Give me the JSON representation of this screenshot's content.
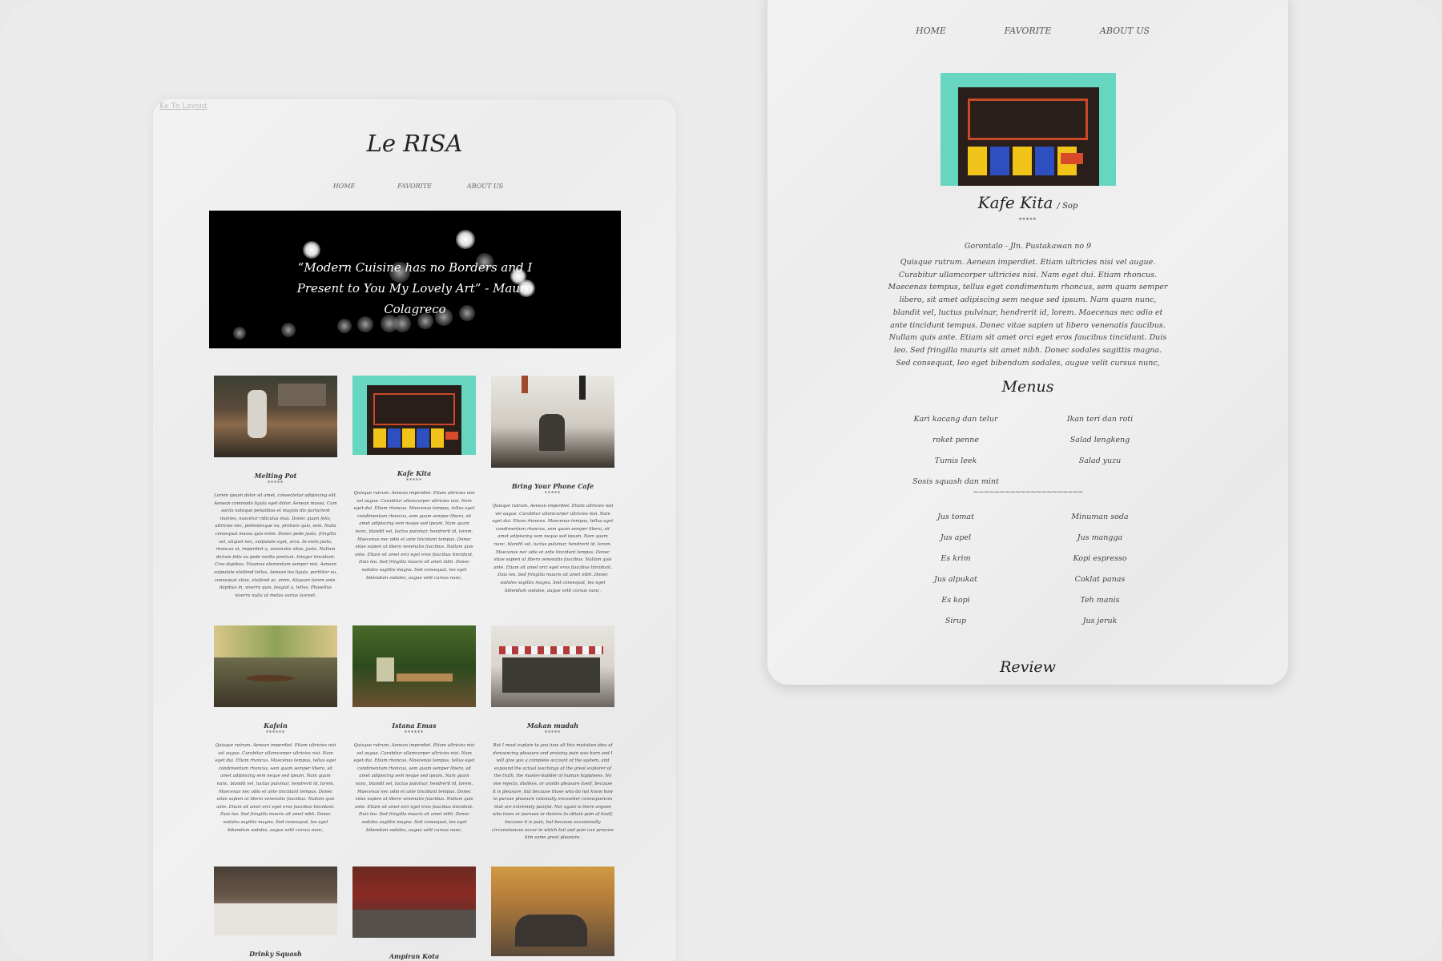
{
  "left_page": {
    "top_link": "Ke To Layout",
    "logo": "Le RISA",
    "nav": [
      "HOME",
      "FAVORITE",
      "ABOUT US"
    ],
    "hero_quote": "“Modern Cuisine has no Borders and I Present to You My Lovely Art” - Mauro Colagreco",
    "cards": [
      {
        "name": "Melting Pot",
        "stars": "*****",
        "desc": "Lorem ipsum dolor sit amet, consectetur adipiscing elit. Aenean commodo ligula eget dolor. Aenean massa. Cum sociis natoque penatibus et magnis dis parturient montes, nascetur ridiculus mus. Donec quam felis, ultricies nec, pellentesque eu, pretium quis, sem. Nulla consequat massa quis enim. Donec pede justo, fringilla vel, aliquet nec, vulputate eget, arcu. In enim justo, rhoncus ut, imperdiet a, venenatis vitae, justo. Nullam dictum felis eu pede mollis pretium. Integer tincidunt. Cras dapibus. Vivamus elementum semper nisi. Aenean vulputate eleifend tellus. Aenean leo ligula, porttitor eu, consequat vitae, eleifend ac, enim. Aliquam lorem ante, dapibus in, viverra quis, feugiat a, tellus. Phasellus viverra nulla ut metus varius laoreet."
      },
      {
        "name": "Kafe Kita",
        "stars": "*****",
        "desc": "Quisque rutrum. Aenean imperdiet. Etiam ultricies nisi vel augue. Curabitur ullamcorper ultricies nisi. Nam eget dui. Etiam rhoncus. Maecenas tempus, tellus eget condimentum rhoncus, sem quam semper libero, sit amet adipiscing sem neque sed ipsum. Nam quam nunc, blandit vel, luctus pulvinar, hendrerit id, lorem. Maecenas nec odio et ante tincidunt tempus. Donec vitae sapien ut libero venenatis faucibus. Nullam quis ante. Etiam sit amet orci eget eros faucibus tincidunt. Duis leo. Sed fringilla mauris sit amet nibh. Donec sodales sagittis magna. Sed consequat, leo eget bibendum sodales, augue velit cursus nunc,"
      },
      {
        "name": "Bring Your Phone Cafe",
        "stars": "*****",
        "desc": "Quisque rutrum. Aenean imperdiet. Etiam ultricies nisi vel augue. Curabitur ullamcorper ultricies nisi. Nam eget dui. Etiam rhoncus. Maecenas tempus, tellus eget condimentum rhoncus, sem quam semper libero, sit amet adipiscing sem neque sed ipsum. Nam quam nunc, blandit vel, luctus pulvinar, hendrerit id, lorem. Maecenas nec odio et ante tincidunt tempus. Donec vitae sapien ut libero venenatis faucibus. Nullam quis ante. Etiam sit amet orci eget eros faucibus tincidunt. Duis leo. Sed fringilla mauris sit amet nibh. Donec sodales sagittis magna. Sed consequat, leo eget bibendum sodales, augue velit cursus nunc,"
      },
      {
        "name": "Kafein",
        "stars": "******",
        "desc": "Quisque rutrum. Aenean imperdiet. Etiam ultricies nisi vel augue. Curabitur ullamcorper ultricies nisi. Nam eget dui. Etiam rhoncus. Maecenas tempus, tellus eget condimentum rhoncus, sem quam semper libero, sit amet adipiscing sem neque sed ipsum. Nam quam nunc, blandit vel, luctus pulvinar, hendrerit id, lorem. Maecenas nec odio et ante tincidunt tempus. Donec vitae sapien ut libero venenatis faucibus. Nullam quis ante. Etiam sit amet orci eget eros faucibus tincidunt. Duis leo. Sed fringilla mauris sit amet nibh. Donec sodales sagittis magna. Sed consequat, leo eget bibendum sodales, augue velit cursus nunc,"
      },
      {
        "name": "Istana Emas",
        "stars": "******",
        "desc": "Quisque rutrum. Aenean imperdiet. Etiam ultricies nisi vel augue. Curabitur ullamcorper ultricies nisi. Nam eget dui. Etiam rhoncus. Maecenas tempus, tellus eget condimentum rhoncus, sem quam semper libero, sit amet adipiscing sem neque sed ipsum. Nam quam nunc, blandit vel, luctus pulvinar, hendrerit id, lorem. Maecenas nec odio et ante tincidunt tempus. Donec vitae sapien ut libero venenatis faucibus. Nullam quis ante. Etiam sit amet orci eget eros faucibus tincidunt. Duis leo. Sed fringilla mauris sit amet nibh. Donec sodales sagittis magna. Sed consequat, leo eget bibendum sodales, augue velit cursus nunc,"
      },
      {
        "name": "Makan mudah",
        "stars": "*****",
        "desc": "But I must explain to you how all this mistaken idea of denouncing pleasure and praising pain was born and I will give you a complete account of the system, and expound the actual teachings of the great explorer of the truth, the master-builder of human happiness. No one rejects, dislikes, or avoids pleasure itself, because it is pleasure, but because those who do not know how to pursue pleasure rationally encounter consequences that are extremely painful. Nor again is there anyone who loves or pursues or desires to obtain pain of itself, because it is pain, but because occasionally circumstances occur in which toil and pain can procure him some great pleasure."
      },
      {
        "name": "Drinky Squash",
        "stars": "",
        "desc": ""
      },
      {
        "name": "Ampiran Kota",
        "stars": "",
        "desc": ""
      },
      {
        "name": "",
        "stars": "",
        "desc": ""
      }
    ]
  },
  "right_page": {
    "nav": [
      "HOME",
      "FAVORITE",
      "ABOUT US"
    ],
    "title": "Kafe Kita",
    "subtitle": "/ Sop",
    "stars": "*****",
    "address": "Gorontalo - Jln. Pustakawan no 9",
    "about": "Quisque rutrum. Aenean imperdiet. Etiam ultricies nisi vel augue. Curabitur ullamcorper ultricies nisi. Nam eget dui. Etiam rhoncus. Maecenas tempus, tellus eget condimentum rhoncus, sem quam semper libero, sit amet adipiscing sem neque sed ipsum. Nam quam nunc, blandit vel, luctus pulvinar, hendrerit id, lorem. Maecenas nec odio et ante tincidunt tempus. Donec vitae sapien ut libero venenatis faucibus. Nullam quis ante. Etiam sit amet orci eget eros faucibus tincidunt. Duis leo. Sed fringilla mauris sit amet nibh. Donec sodales sagittis magna. Sed consequat, leo eget bibendum sodales, augue velit cursus nunc,",
    "menus_heading": "Menus",
    "food_menu": [
      "Kari kacang dan telur",
      "Ikan teri dan roti",
      "roket penne",
      "Salad lengkeng",
      "Tumis leek",
      "Salad yuzu",
      "Sosis squash dan mint"
    ],
    "divider": "~~~~~~~~~~~~~~~~~~~~~",
    "drink_menu": [
      "Jus tomat",
      "Minuman soda",
      "Jus apel",
      "Jus mangga",
      "Es krim",
      "Kopi espresso",
      "Jus alpukat",
      "Coklat panas",
      "Es kopi",
      "Teh manis",
      "Sirup",
      "Jus jeruk"
    ],
    "review_heading": "Review"
  },
  "colors": {
    "background": "#ebebeb",
    "paper": "#efefef",
    "hero": "#000000",
    "text": "#333333",
    "teal_storefront": "#66d6c0"
  }
}
